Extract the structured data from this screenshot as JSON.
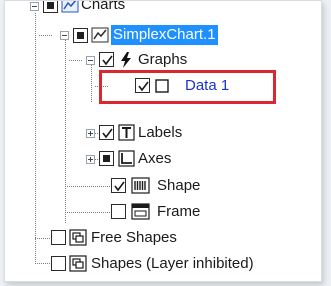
{
  "tree": {
    "nodes": [
      {
        "label": "Charts"
      },
      {
        "label": "SimplexChart.1"
      },
      {
        "label": "Graphs"
      },
      {
        "label": "Data 1"
      },
      {
        "label": "Labels"
      },
      {
        "label": "Axes"
      },
      {
        "label": "Shape"
      },
      {
        "label": "Frame"
      },
      {
        "label": "Free Shapes"
      },
      {
        "label": "Shapes (Layer inhibited)"
      }
    ]
  },
  "colors": {
    "selection": "#1e90ff",
    "highlight_border": "#d9282f",
    "focus_text": "#1a32d6"
  }
}
